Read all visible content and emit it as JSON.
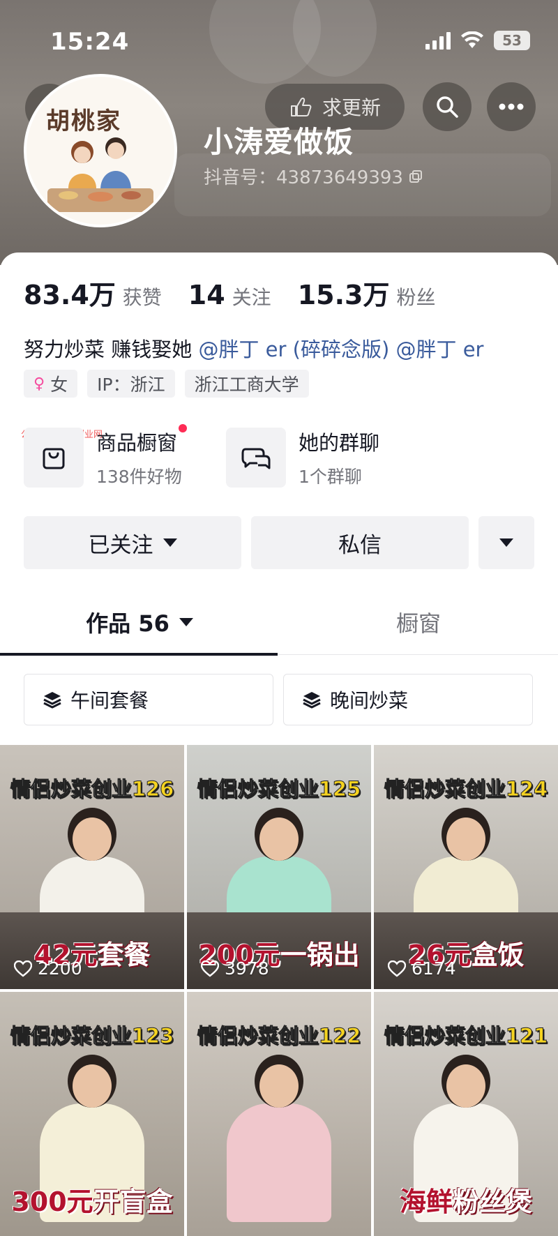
{
  "status": {
    "time": "15:24",
    "battery": "53"
  },
  "header": {
    "update_label": "求更新"
  },
  "profile": {
    "avatar_text": "胡桃家",
    "name": "小涛爱做饭",
    "uid": "抖音号：43873649393"
  },
  "stats": [
    {
      "num": "83.4万",
      "label": "获赞"
    },
    {
      "num": "14",
      "label": "关注"
    },
    {
      "num": "15.3万",
      "label": "粉丝"
    }
  ],
  "bio": {
    "text": "努力炒菜 赚钱娶她",
    "mention1": "@胖丁 er (碎碎念版)",
    "mention2": "@胖丁 er"
  },
  "tags": [
    "女",
    "IP：浙江",
    "浙江工商大学"
  ],
  "watermark": "公众号：优选副业网",
  "entries": [
    {
      "title": "商品橱窗",
      "sub": "138件好物"
    },
    {
      "title": "她的群聊",
      "sub": "1个群聊"
    }
  ],
  "actions": {
    "followed": "已关注",
    "message": "私信"
  },
  "tabs": {
    "works": "作品 56",
    "showcase": "橱窗"
  },
  "playlists": [
    "午间套餐",
    "晚间炒菜"
  ],
  "videos": [
    {
      "title": "情侣炒菜创业",
      "num": "126",
      "price_red": "42元",
      "price_white": "套餐",
      "likes": "2200"
    },
    {
      "title": "情侣炒菜创业",
      "num": "125",
      "price_red": "200元",
      "price_white": "一锅出",
      "likes": "3978"
    },
    {
      "title": "情侣炒菜创业",
      "num": "124",
      "price_red": "26元",
      "price_white": "盒饭",
      "likes": "6174"
    },
    {
      "title": "情侣炒菜创业",
      "num": "123",
      "price_red": "300元",
      "price_white": "开盲盒",
      "likes": ""
    },
    {
      "title": "情侣炒菜创业",
      "num": "122",
      "price_red": "",
      "price_white": "",
      "likes": ""
    },
    {
      "title": "情侣炒菜创业",
      "num": "121",
      "price_red": "海鲜",
      "price_white": "粉丝煲",
      "likes": ""
    }
  ],
  "colors": {
    "accent_red": "#fe2c55",
    "mention_blue": "#3a5b9c",
    "cover_yellow": "#f5d320"
  }
}
